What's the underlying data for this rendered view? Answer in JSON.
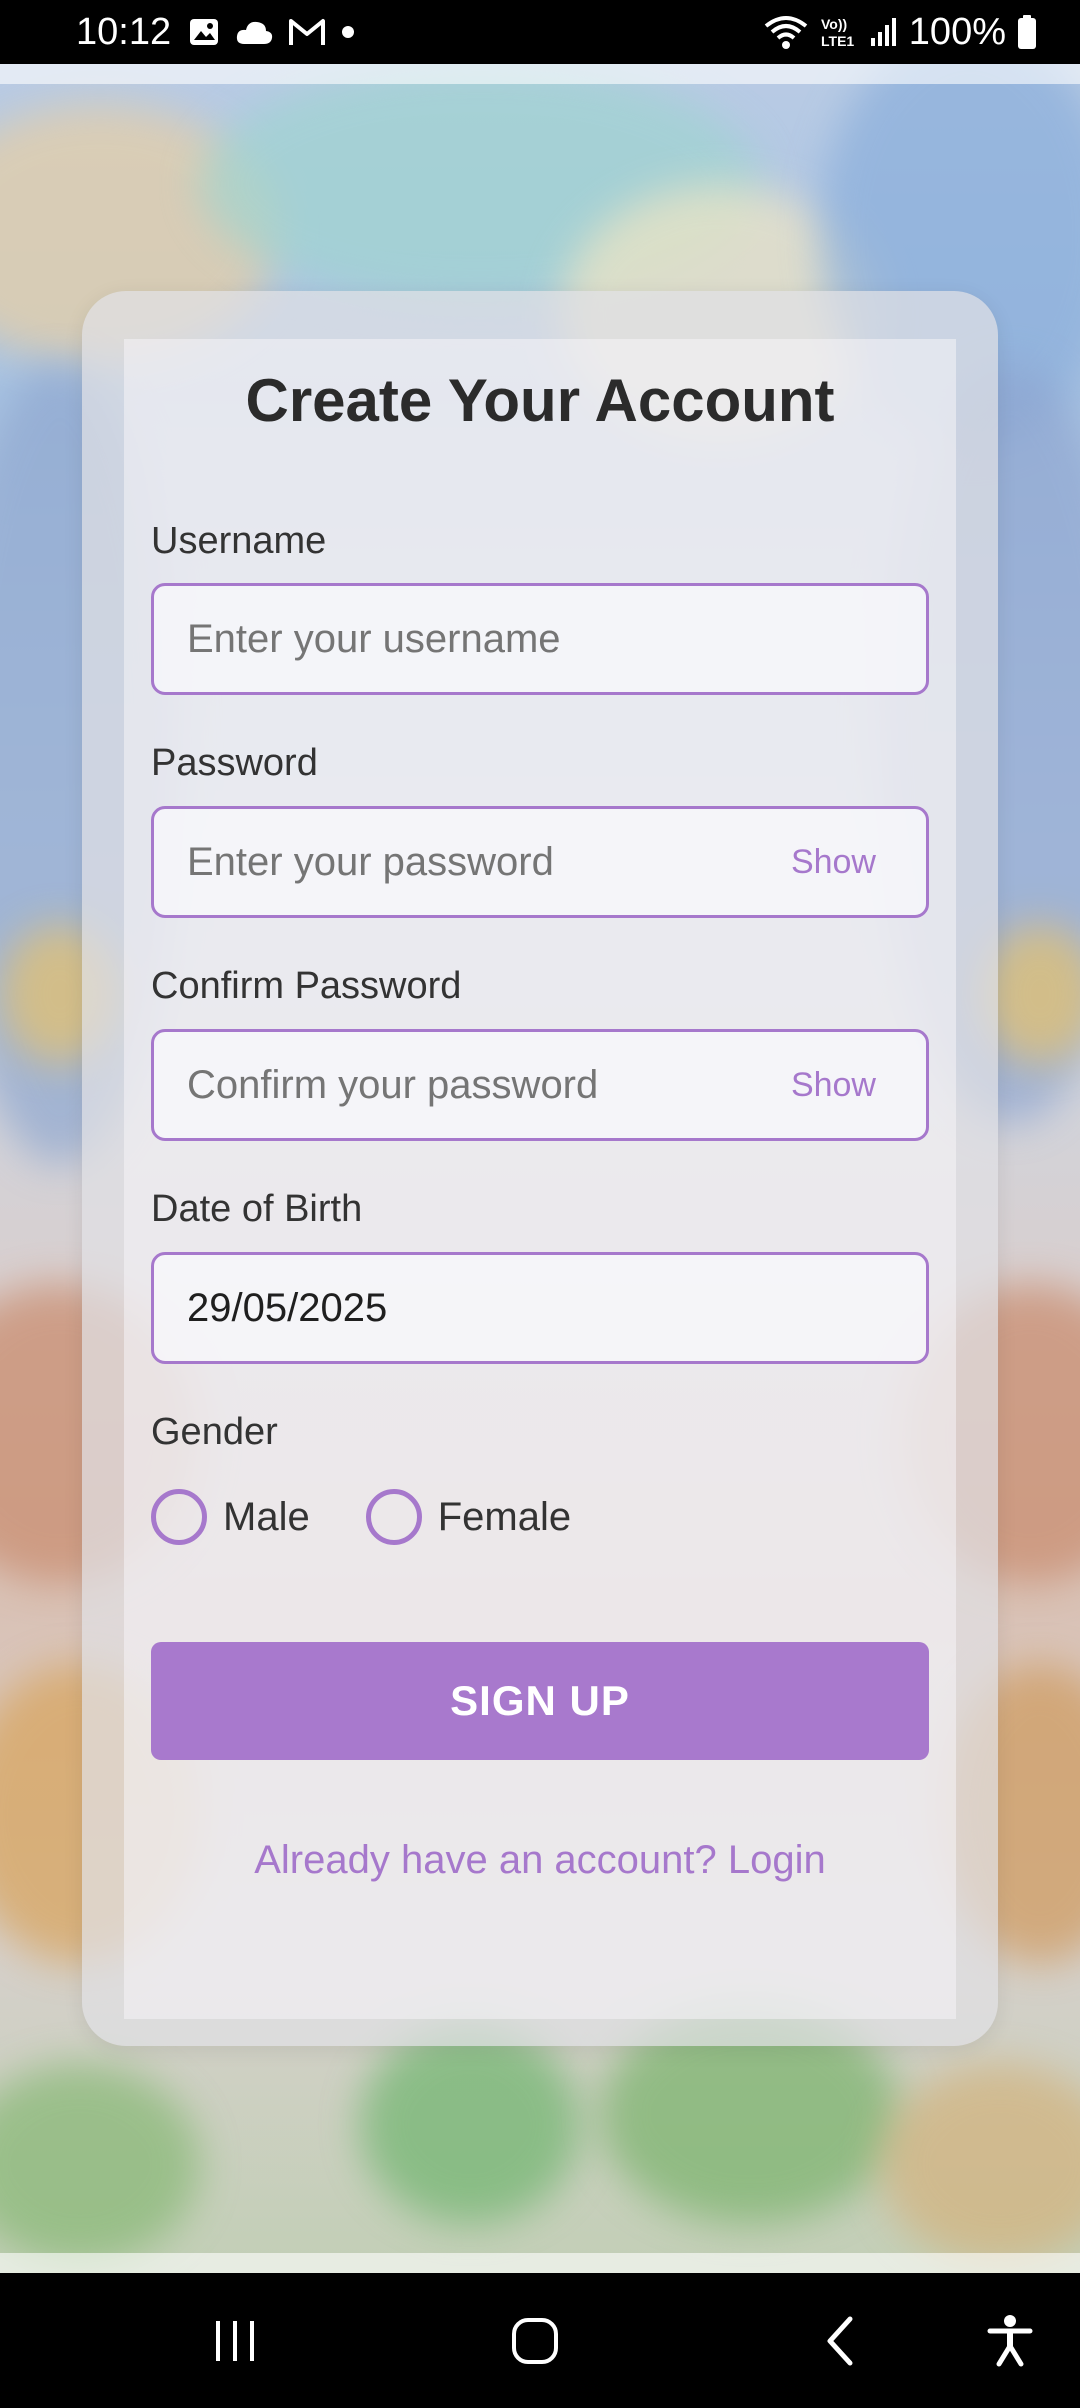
{
  "status_bar": {
    "time": "10:12",
    "left_icons": [
      "image-icon",
      "cloud-icon",
      "gmail-icon",
      "dot-icon"
    ],
    "right_icons": [
      "wifi-icon",
      "volte-icon",
      "signal-icon"
    ],
    "battery_text": "100%"
  },
  "form": {
    "title": "Create Your Account",
    "username": {
      "label": "Username",
      "placeholder": "Enter your username"
    },
    "password": {
      "label": "Password",
      "placeholder": "Enter your password",
      "toggle": "Show"
    },
    "confirm_password": {
      "label": "Confirm Password",
      "placeholder": "Confirm your password",
      "toggle": "Show"
    },
    "dob": {
      "label": "Date of Birth",
      "value": "29/05/2025"
    },
    "gender": {
      "label": "Gender",
      "options": [
        "Male",
        "Female"
      ]
    },
    "submit_label": "SIGN UP",
    "login_link": "Already have an account? Login"
  },
  "colors": {
    "accent": "#a678cc",
    "button": "#a879cd"
  },
  "nav_bar": {
    "buttons": [
      "recent-apps-icon",
      "home-icon",
      "back-icon",
      "accessibility-icon"
    ]
  }
}
